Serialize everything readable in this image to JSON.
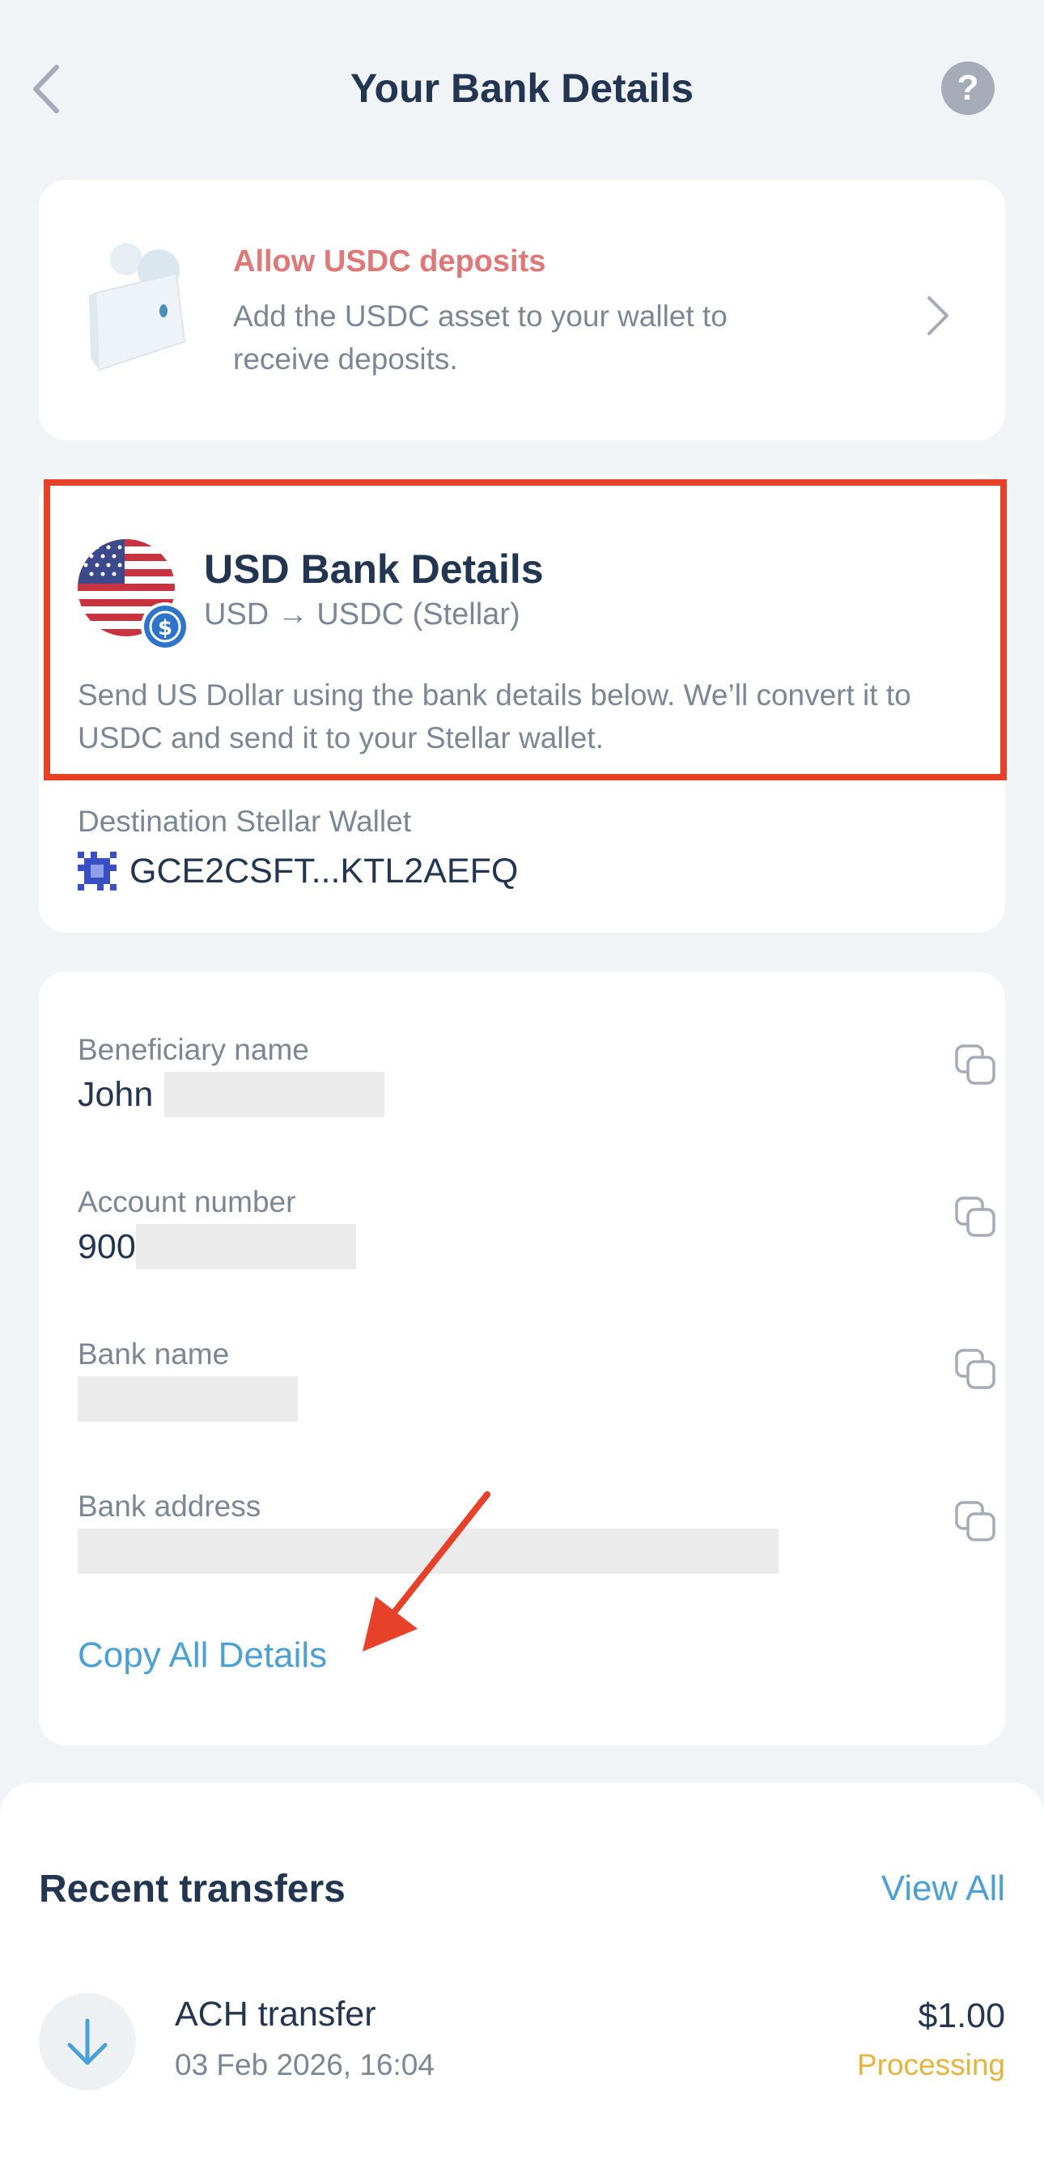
{
  "header": {
    "title": "Your Bank Details",
    "help_label": "?"
  },
  "deposit_prompt": {
    "title": "Allow USDC deposits",
    "description": "Add the USDC asset to your wallet to receive deposits."
  },
  "bank_header": {
    "title": "USD Bank Details",
    "subtitle": "USD → USDC (Stellar)",
    "description": "Send US Dollar using the bank details below. We’ll convert it to USDC and send it to your Stellar wallet.",
    "destination_label": "Destination Stellar Wallet",
    "destination_value": "GCE2CSFT...KTL2AEFQ"
  },
  "fields": [
    {
      "label": "Beneficiary name",
      "value": "John"
    },
    {
      "label": "Account number",
      "value": "900"
    },
    {
      "label": "Bank name",
      "value": ""
    },
    {
      "label": "Bank address",
      "value": ""
    }
  ],
  "copy_all_label": "Copy All Details",
  "recent": {
    "title": "Recent transfers",
    "view_all": "View All",
    "items": [
      {
        "name": "ACH transfer",
        "date": "03 Feb 2026, 16:04",
        "amount": "$1.00",
        "status": "Processing"
      }
    ]
  },
  "colors": {
    "accent": "#4aa1da",
    "warning": "#e6b43a",
    "highlight": "#e8412a",
    "prompt_title": "#e07878"
  }
}
